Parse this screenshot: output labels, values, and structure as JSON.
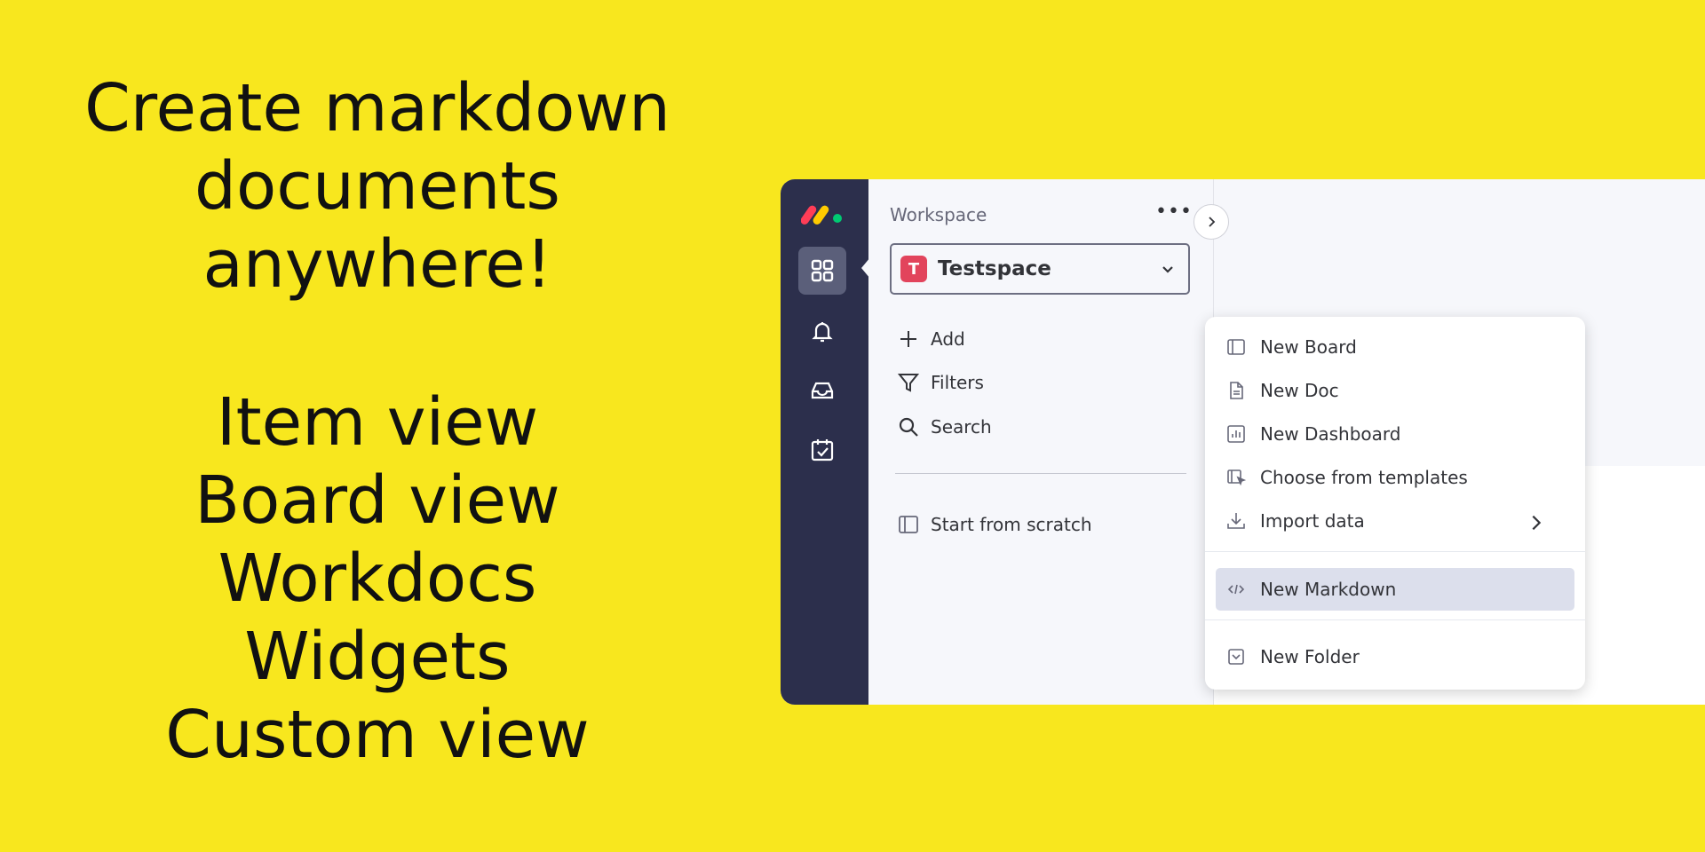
{
  "promo": {
    "headline_line1": "Create markdown",
    "headline_line2": "documents anywhere!",
    "features": [
      "Item view",
      "Board view",
      "Workdocs",
      "Widgets",
      "Custom view"
    ]
  },
  "rail": {
    "items": [
      {
        "icon": "grid-icon",
        "active": true
      },
      {
        "icon": "bell-icon",
        "active": false
      },
      {
        "icon": "inbox-icon",
        "active": false
      },
      {
        "icon": "calendar-check-icon",
        "active": false
      }
    ]
  },
  "sidebar": {
    "workspace_label": "Workspace",
    "more_label": "•••",
    "workspace": {
      "avatar_letter": "T",
      "name": "Testspace"
    },
    "actions": [
      {
        "icon": "plus-icon",
        "label": "Add"
      },
      {
        "icon": "filter-icon",
        "label": "Filters"
      },
      {
        "icon": "search-icon",
        "label": "Search"
      }
    ],
    "start_from_scratch": "Start from scratch"
  },
  "menu": {
    "items": [
      {
        "icon": "board-icon",
        "label": "New Board"
      },
      {
        "icon": "doc-icon",
        "label": "New Doc"
      },
      {
        "icon": "dashboard-icon",
        "label": "New Dashboard"
      },
      {
        "icon": "template-icon",
        "label": "Choose from templates"
      },
      {
        "icon": "import-icon",
        "label": "Import data"
      },
      {
        "icon": "code-icon",
        "label": "New Markdown"
      },
      {
        "icon": "folder-icon",
        "label": "New Folder"
      }
    ]
  },
  "colors": {
    "background": "#f8e71e",
    "rail": "#2c2f4c",
    "avatar": "#e2445c",
    "highlight": "#dcdfec"
  }
}
